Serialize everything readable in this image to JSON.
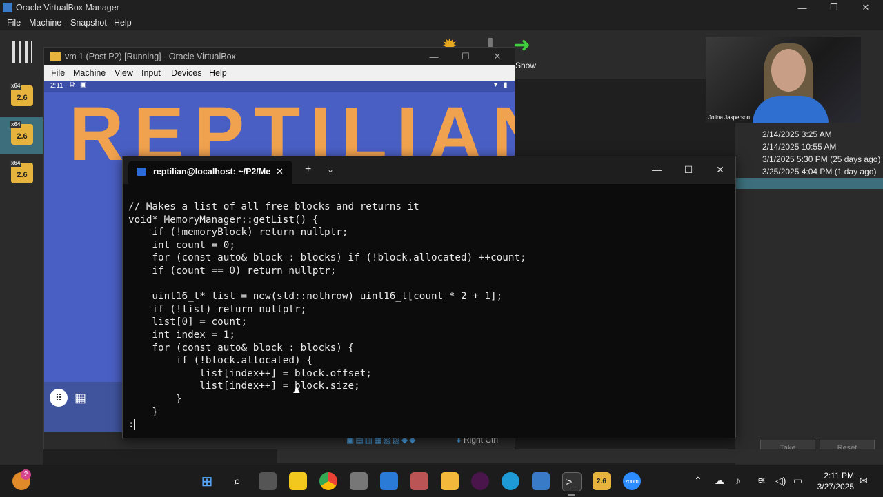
{
  "host": {
    "title": "Oracle VirtualBox Manager",
    "menu": [
      "File",
      "Machine",
      "Snapshot",
      "Help"
    ],
    "show_label": "Show",
    "vm_badge": "2.6",
    "vm_badge_arch": "x64",
    "snapshots": [
      "2/14/2025 3:25 AM",
      "2/14/2025 10:55 AM",
      "3/1/2025 5:30 PM (25 days ago)",
      "3/25/2025 4:04 PM (1 day ago)"
    ],
    "take_label": "Take",
    "reset_label": "Reset"
  },
  "webcam": {
    "name": "Jolina Jasperson"
  },
  "vm": {
    "title": "vm 1 (Post P2) [Running] - Oracle VirtualBox",
    "menu": [
      "File",
      "Machine",
      "View",
      "Input",
      "Devices",
      "Help"
    ],
    "guest_time": "2:11",
    "logo_text": "REPTILIAN",
    "host_key": "Right Ctrl"
  },
  "terminal": {
    "tab_title": "reptilian@localhost: ~/P2/Me",
    "code": "// Makes a list of all free blocks and returns it\nvoid* MemoryManager::getList() {\n    if (!memoryBlock) return nullptr;\n    int count = 0;\n    for (const auto& block : blocks) if (!block.allocated) ++count;\n    if (count == 0) return nullptr;\n\n    uint16_t* list = new(std::nothrow) uint16_t[count * 2 + 1];\n    if (!list) return nullptr;\n    list[0] = count;\n    int index = 1;\n    for (const auto& block : blocks) {\n        if (!block.allocated) {\n            list[index++] = block.offset;\n            list[index++] = block.size;\n        }\n    }",
    "prompt": ":"
  },
  "taskbar": {
    "time": "2:11 PM",
    "date": "3/27/2025",
    "notification_count": "2",
    "vbox_badge": "2.6",
    "zoom_label": "zoom"
  }
}
